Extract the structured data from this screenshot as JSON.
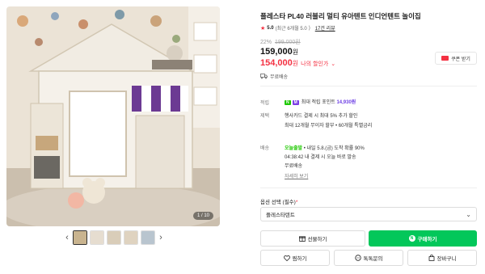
{
  "gallery": {
    "image_counter": "1 / 10",
    "thumbnails": [
      {
        "label": "thumb-1",
        "color": "#c9b48f"
      },
      {
        "label": "thumb-2",
        "color": "#e6ddd0"
      },
      {
        "label": "thumb-3",
        "color": "#d9cdb9"
      },
      {
        "label": "thumb-4",
        "color": "#dfd3c0"
      },
      {
        "label": "thumb-5",
        "color": "#b9c5cf"
      }
    ]
  },
  "product": {
    "title": "플레스타 PL40 러블리 멀티 유아텐트 인디언텐트 놀이집",
    "rating": "5.0",
    "rating_note": "(최근 6개월 5.0",
    "review_link": "17건 리뷰",
    "discount_rate": "22%",
    "original_price": "199,000원",
    "price": "159,000",
    "price_unit": "원",
    "my_price": "154,000",
    "my_price_unit": "원",
    "my_price_label": "나의 할인가",
    "shipping": "무료배송",
    "coupon_label": "쿠폰 받기"
  },
  "specs": {
    "point_label": "적립",
    "point_badge_n": "N",
    "point_badge_m": "M",
    "point_text": "최대 적립 포인트",
    "point_value": "14,930원",
    "card_label": "제택",
    "card_line1": "행사카드 결제 시 최대 5% 추가 할인",
    "card_line2": "최대 12개월 무이자 할부 • 60개월 특별금리",
    "delivery_label": "배송",
    "delivery_today": "오늘출발",
    "delivery_line1_rest": "• 내일 5.8.(금) 도착 확률 90%",
    "delivery_time": "04:38:42",
    "delivery_line2_rest": "내 결제 시 오늘 바로 발송",
    "delivery_line3": "무료배송",
    "detail_link": "자세히 보기"
  },
  "options": {
    "label": "옵션 선택 (필수)",
    "required_mark": "*",
    "selected": "플레스타텐트"
  },
  "actions": {
    "gift": "선물하기",
    "buy": "구매하기",
    "npay": "N",
    "wish": "찜하기",
    "talk": "톡톡문의",
    "cart": "장바구니"
  },
  "colors": {
    "accent_red": "#f43142",
    "naver_green": "#03c75a",
    "point_purple": "#6d3fe4"
  }
}
